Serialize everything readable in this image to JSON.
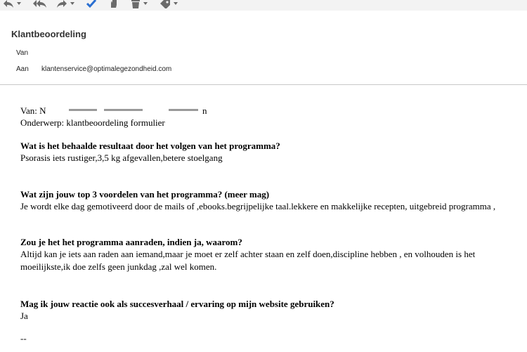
{
  "toolbar": {
    "icons": [
      {
        "name": "reply-icon",
        "has_menu": true
      },
      {
        "name": "reply-all-icon",
        "has_menu": false
      },
      {
        "name": "forward-icon",
        "has_menu": true
      },
      {
        "name": "check-icon",
        "has_menu": false
      },
      {
        "name": "hand-icon",
        "has_menu": false
      },
      {
        "name": "delete-icon",
        "has_menu": true
      },
      {
        "name": "tag-icon",
        "has_menu": true
      }
    ],
    "colors": {
      "background": "#f3f3f3",
      "icon": "#6b6b6b",
      "check": "#2a6fd1"
    }
  },
  "header": {
    "subject": "Klantbeoordeling",
    "from_label": "Van",
    "to_label": "Aan",
    "to_value": "klantenservice@optimalegezondheid.com"
  },
  "message": {
    "from_line": "Van: N",
    "from_tail": "n",
    "subject_line": "Onderwerp: klantbeoordeling formulier",
    "q1": "Wat is het behaalde resultaat door het volgen van het programma?",
    "a1": "Psorasis iets rustiger,3,5 kg afgevallen,betere stoelgang",
    "q2": "Wat zijn jouw top 3 voordelen van het programma? (meer mag)",
    "a2": "Je wordt elke dag gemotiveerd door de mails of ,ebooks.begrijpelijke taal.lekkere en makkelijke recepten, uitgebreid programma ,",
    "q3": "Zou je het het programma aanraden, indien ja, waarom?",
    "a3_line1": "Altijd kan je iets aan raden aan iemand,maar je moet er zelf achter staan en zelf doen,discipline hebben , en volhouden is het",
    "a3_line2": "moeilijkste,ik doe zelfs geen junkdag ,zal wel komen.",
    "q4": "Mag ik jouw reactie ook als succesverhaal / ervaring op mijn website gebruiken?",
    "a4": "Ja",
    "signature_sep": "--"
  }
}
